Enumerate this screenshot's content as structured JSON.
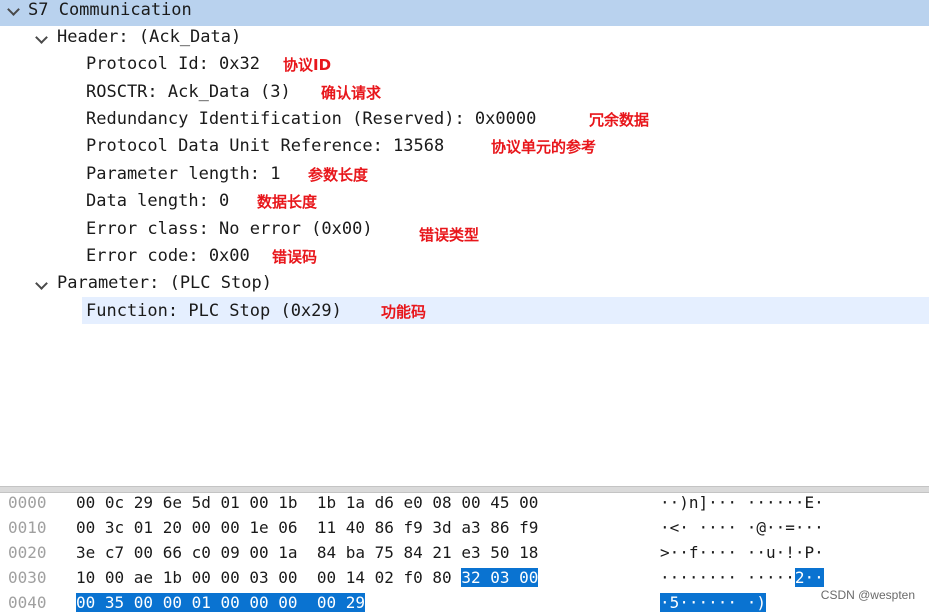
{
  "tree": {
    "s7": {
      "label": "S7 Communication"
    },
    "header": {
      "label": "Header: (Ack_Data)",
      "fields": [
        {
          "text": "Protocol Id: 0x32",
          "note": "协议ID"
        },
        {
          "text": "ROSCTR: Ack_Data (3)",
          "note": "确认请求"
        },
        {
          "text": "Redundancy Identification (Reserved): 0x0000",
          "note": "冗余数据"
        },
        {
          "text": "Protocol Data Unit Reference: 13568",
          "note": "协议单元的参考"
        },
        {
          "text": "Parameter length: 1",
          "note": "参数长度"
        },
        {
          "text": "Data length: 0",
          "note": "数据长度"
        },
        {
          "text": "Error class: No error (0x00)",
          "note": "错误类型"
        },
        {
          "text": "Error code: 0x00",
          "note": "错误码"
        }
      ]
    },
    "parameter": {
      "label": "Parameter: (PLC Stop)",
      "fields": [
        {
          "text": "Function: PLC Stop (0x29)",
          "note": "功能码"
        }
      ]
    }
  },
  "hexdump": {
    "rows": [
      {
        "offset": "0000",
        "bytes_plain": "00 0c 29 6e 5d 01 00 1b  1b 1a d6 e0 08 00 45 00",
        "bytes_hl": "",
        "ascii_plain": "··)n]··· ······E·",
        "ascii_hl": ""
      },
      {
        "offset": "0010",
        "bytes_plain": "00 3c 01 20 00 00 1e 06  11 40 86 f9 3d a3 86 f9",
        "bytes_hl": "",
        "ascii_plain": "·<· ···· ·@··=···",
        "ascii_hl": ""
      },
      {
        "offset": "0020",
        "bytes_plain": "3e c7 00 66 c0 09 00 1a  84 ba 75 84 21 e3 50 18",
        "bytes_hl": "",
        "ascii_plain": ">··f···· ··u·!·P·",
        "ascii_hl": ""
      },
      {
        "offset": "0030",
        "bytes_plain": "10 00 ae 1b 00 00 03 00  00 14 02 f0 80 ",
        "bytes_hl": "32 03 00",
        "ascii_plain": "········ ·····",
        "ascii_hl": "2··"
      },
      {
        "offset": "0040",
        "bytes_plain": "",
        "bytes_hl": "00 35 00 00 01 00 00 00  00 29",
        "ascii_plain": "",
        "ascii_hl": "·5······ ·)"
      }
    ]
  },
  "watermark": "CSDN @wespten",
  "colors": {
    "header_row_bg": "#b9d2ee",
    "selected_row_bg": "#e5efff",
    "hex_highlight_bg": "#0a73d1",
    "annotation_red": "#e8161b"
  }
}
